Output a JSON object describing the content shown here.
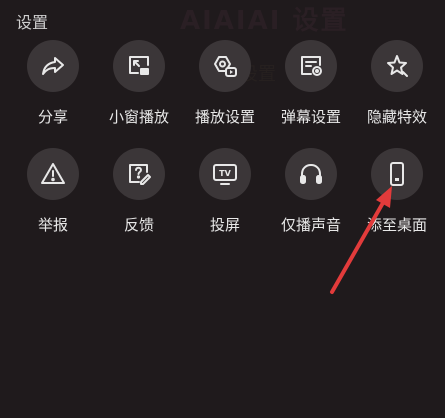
{
  "panel": {
    "title": "设置"
  },
  "row1": [
    {
      "label": "分享",
      "icon": "share-icon"
    },
    {
      "label": "小窗播放",
      "icon": "picture-in-picture-icon"
    },
    {
      "label": "播放设置",
      "icon": "play-settings-icon"
    },
    {
      "label": "弹幕设置",
      "icon": "danmaku-settings-icon"
    },
    {
      "label": "隐藏特效",
      "icon": "hide-effects-icon"
    }
  ],
  "row2": [
    {
      "label": "举报",
      "icon": "warning-icon"
    },
    {
      "label": "反馈",
      "icon": "feedback-icon"
    },
    {
      "label": "投屏",
      "icon": "tv-cast-icon"
    },
    {
      "label": "仅播声音",
      "icon": "headphones-icon"
    },
    {
      "label": "添至桌面",
      "icon": "phone-icon"
    }
  ],
  "colors": {
    "background": "#1f1a1c",
    "circle": "#3b3638",
    "arrow": "#e23b3b"
  },
  "background_text": {
    "top": "AIAIAI 设置",
    "mid": "设置"
  }
}
